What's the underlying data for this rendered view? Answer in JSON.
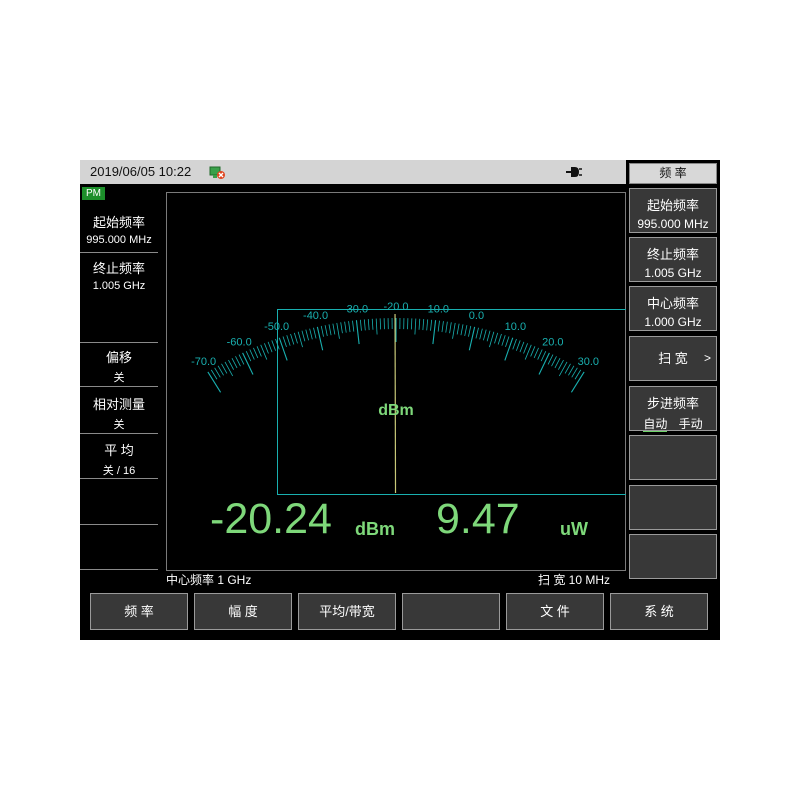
{
  "status": {
    "datetime": "2019/06/05 10:22",
    "network_icon": "network-error-icon",
    "power_icon": "plug-icon"
  },
  "left_panel": {
    "mode_badge": "PM",
    "items": [
      {
        "title": "起始频率",
        "value": "995.000 MHz"
      },
      {
        "title": "终止频率",
        "value": "1.005 GHz"
      },
      {
        "title": "偏移",
        "value": "关"
      },
      {
        "title": "相对测量",
        "value": "关"
      },
      {
        "title": "平 均",
        "value": "关 / 16"
      }
    ]
  },
  "meter": {
    "scale_labels": [
      "-70.0",
      "-60.0",
      "-50.0",
      "-40.0",
      "-30.0",
      "-20.0",
      "-10.0",
      "0.0",
      "10.0",
      "20.0",
      "30.0"
    ],
    "scale_min": -70,
    "scale_max": 30,
    "needle_value": -20.24,
    "unit_label": "dBm",
    "colors": {
      "scale": "#19b0b0",
      "needle": "#c8c878",
      "readout": "#7ed87a"
    }
  },
  "readout": {
    "power_dbm": "-20.24",
    "power_dbm_unit": "dBm",
    "power_w": "9.47",
    "power_w_unit": "uW"
  },
  "footer": {
    "center_freq": "中心频率  1 GHz",
    "span": "扫 宽  10 MHz"
  },
  "right_panel": {
    "title": "频 率",
    "keys": [
      {
        "title": "起始频率",
        "value": "995.000 MHz"
      },
      {
        "title": "终止频率",
        "value": "1.005 GHz"
      },
      {
        "title": "中心频率",
        "value": "1.000 GHz"
      },
      {
        "label": "扫 宽",
        "arrow": ">"
      },
      {
        "title": "步进频率",
        "opt_on": "自动",
        "opt_off": "手动"
      }
    ]
  },
  "bottom_menu": [
    "频 率",
    "幅 度",
    "平均/带宽",
    "",
    "文 件",
    "系 统"
  ]
}
